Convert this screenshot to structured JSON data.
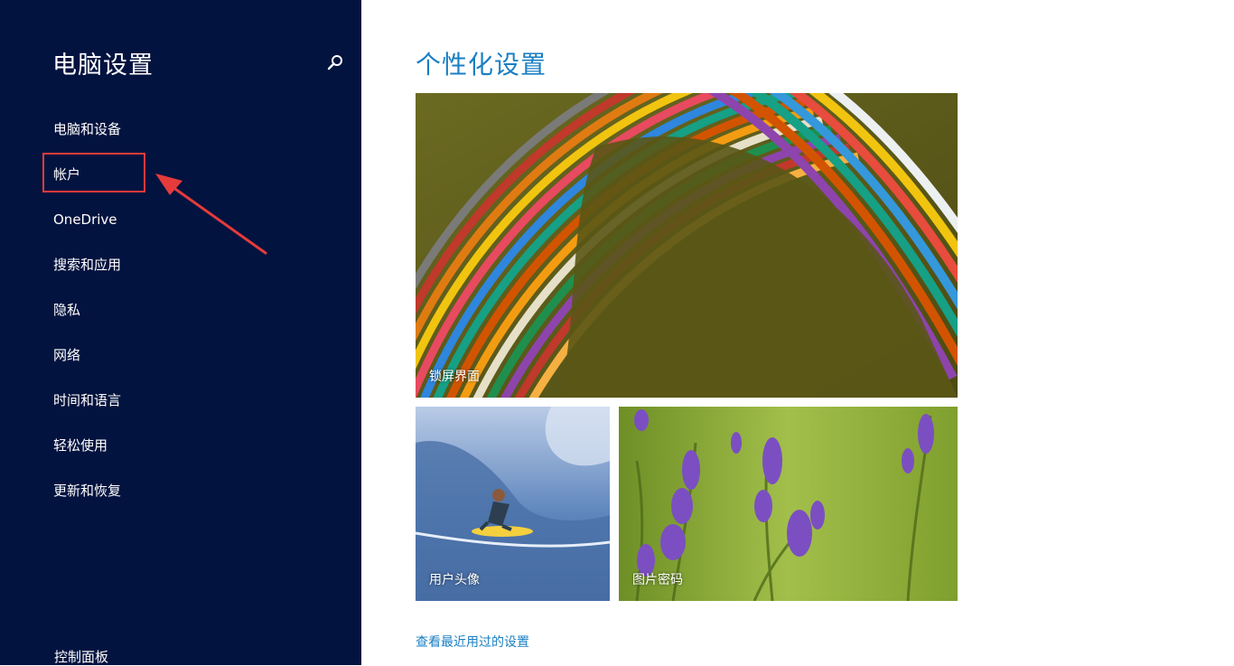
{
  "sidebar": {
    "title": "电脑设置",
    "search_icon": "search-icon",
    "items": [
      {
        "label": "电脑和设备"
      },
      {
        "label": "帐户"
      },
      {
        "label": "OneDrive"
      },
      {
        "label": "搜索和应用"
      },
      {
        "label": "隐私"
      },
      {
        "label": "网络"
      },
      {
        "label": "时间和语言"
      },
      {
        "label": "轻松使用"
      },
      {
        "label": "更新和恢复"
      }
    ],
    "control_panel": "控制面板",
    "background_color": "#03133f"
  },
  "annotation": {
    "highlight_color": "#e53b3b"
  },
  "main": {
    "title": "个性化设置",
    "title_color": "#1a7fc3",
    "tiles": {
      "lock_screen": "锁屏界面",
      "account_picture": "用户头像",
      "picture_password": "图片密码"
    },
    "recent_link": "查看最近用过的设置"
  }
}
